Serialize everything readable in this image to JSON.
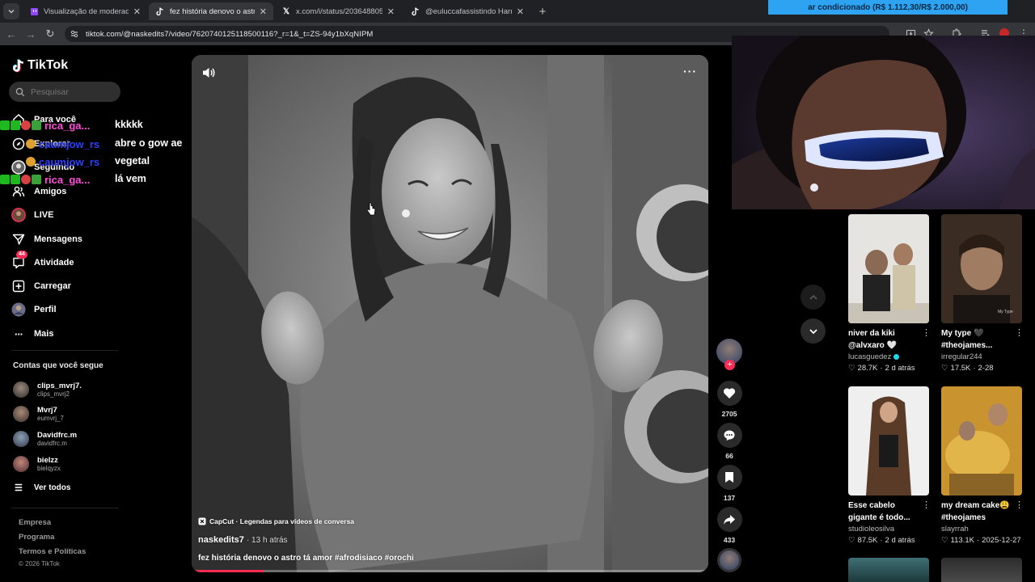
{
  "browser": {
    "tabs": [
      {
        "title": "Visualização de moderadores d",
        "icon": "twitch-icon"
      },
      {
        "title": "fez história denovo o astro tá a",
        "icon": "tiktok-icon",
        "active": true
      },
      {
        "title": "x.com/i/status/20364880597875",
        "icon": "x-icon"
      },
      {
        "title": "@euluccafassistindo Harry Pott",
        "icon": "tiktok-icon"
      }
    ],
    "url": "tiktok.com/@naskedits7/video/7620740125118500116?_r=1&_t=ZS-94y1bXqNIPM",
    "banner": "ar condicionado (R$ 1.112,30/R$ 2.000,00)"
  },
  "tiktok": {
    "brand": "TikTok",
    "search_placeholder": "Pesquisar",
    "nav": [
      {
        "label": "Para você",
        "icon": "home-icon"
      },
      {
        "label": "Explorar",
        "icon": "compass-icon"
      },
      {
        "label": "Seguindo",
        "icon": "following-icon"
      },
      {
        "label": "Amigos",
        "icon": "friends-icon"
      },
      {
        "label": "LIVE",
        "icon": "live-icon"
      },
      {
        "label": "Mensagens",
        "icon": "messages-icon"
      },
      {
        "label": "Atividade",
        "icon": "activity-icon",
        "badge": "44"
      },
      {
        "label": "Carregar",
        "icon": "upload-icon"
      },
      {
        "label": "Perfil",
        "icon": "profile-icon"
      },
      {
        "label": "Mais",
        "icon": "more-icon"
      }
    ],
    "following_title": "Contas que você segue",
    "following": [
      {
        "name": "clips_mvrj7.",
        "handle": "clips_mvrj2"
      },
      {
        "name": "Mvrj7",
        "handle": "eumvrj_7"
      },
      {
        "name": "Davidfrc.m",
        "handle": "davidfrc.m"
      },
      {
        "name": "bielzz",
        "handle": "bielqyzx"
      }
    ],
    "see_all": "Ver todos",
    "footer": [
      "Empresa",
      "Programa",
      "Termos e Políticas"
    ],
    "copyright": "© 2026 TikTok"
  },
  "chat": [
    {
      "user": "rica_ga...",
      "msg": "kkkkk",
      "color": "#ff4fd8"
    },
    {
      "user": "caumjow_rs",
      "msg": "abre o gow ae",
      "color": "#2f3fff"
    },
    {
      "user": "caumjow_rs",
      "msg": "vegetal",
      "color": "#2f3fff"
    },
    {
      "user": "rica_ga...",
      "msg": "lá vem",
      "color": "#ff4fd8"
    }
  ],
  "video": {
    "capcut": "CapCut · Legendas para vídeos de conversa",
    "author": "naskedits7",
    "time": "· 13 h atrás",
    "caption": "fez história denovo o astro tá amor #afrodisiaco #orochi",
    "progress": 0.14
  },
  "actions": {
    "likes": "2705",
    "comments": "66",
    "saves": "137",
    "shares": "433"
  },
  "recommended": [
    {
      "title": "niver da kiki @alvxaro 🤍",
      "author": "lucasguedez",
      "verified": true,
      "views": "28.7K",
      "date": "2 d atrás"
    },
    {
      "title": "My type 🖤 #theojames...",
      "author": "irregular244",
      "verified": false,
      "views": "17.5K",
      "date": "2-28"
    },
    {
      "title": "Esse cabelo gigante é todo...",
      "author": "studioleosilva",
      "verified": false,
      "views": "87.5K",
      "date": "2 d atrás"
    },
    {
      "title": "my dream cake😩 #theojames",
      "author": "slayrrah",
      "verified": false,
      "views": "113.1K",
      "date": "2025-12-27"
    }
  ],
  "colors": {
    "accent": "#fe2c55",
    "verified": "#20d5ec"
  }
}
